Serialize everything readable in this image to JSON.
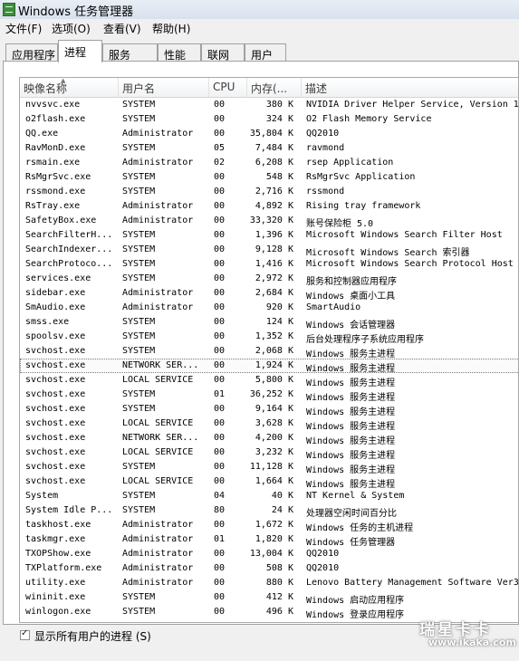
{
  "window": {
    "title": "Windows 任务管理器"
  },
  "menu": [
    "文件(F)",
    "选项(O)",
    "查看(V)",
    "帮助(H)"
  ],
  "tabs": [
    "应用程序",
    "进程",
    "服务",
    "性能",
    "联网",
    "用户"
  ],
  "columns": {
    "name": "映像名称",
    "user": "用户名",
    "cpu": "CPU",
    "mem": "内存(...",
    "desc": "描述"
  },
  "processes": [
    {
      "name": "nvvsvc.exe",
      "user": "SYSTEM",
      "cpu": "00",
      "mem": "380 K",
      "desc": "NVIDIA Driver Helper Service, Version 1"
    },
    {
      "name": "o2flash.exe",
      "user": "SYSTEM",
      "cpu": "00",
      "mem": "324 K",
      "desc": "O2 Flash Memory Service"
    },
    {
      "name": "QQ.exe",
      "user": "Administrator",
      "cpu": "00",
      "mem": "35,804 K",
      "desc": "QQ2010"
    },
    {
      "name": "RavMonD.exe",
      "user": "SYSTEM",
      "cpu": "05",
      "mem": "7,484 K",
      "desc": "ravmond"
    },
    {
      "name": "rsmain.exe",
      "user": "Administrator",
      "cpu": "02",
      "mem": "6,208 K",
      "desc": "rsep Application"
    },
    {
      "name": "RsMgrSvc.exe",
      "user": "SYSTEM",
      "cpu": "00",
      "mem": "548 K",
      "desc": "RsMgrSvc Application"
    },
    {
      "name": "rssmond.exe",
      "user": "SYSTEM",
      "cpu": "00",
      "mem": "2,716 K",
      "desc": "rssmond"
    },
    {
      "name": "RsTray.exe",
      "user": "Administrator",
      "cpu": "00",
      "mem": "4,892 K",
      "desc": "Rising tray framework"
    },
    {
      "name": "SafetyBox.exe",
      "user": "Administrator",
      "cpu": "00",
      "mem": "33,320 K",
      "desc": "账号保险柜 5.0"
    },
    {
      "name": "SearchFilterH...",
      "user": "SYSTEM",
      "cpu": "00",
      "mem": "1,396 K",
      "desc": "Microsoft Windows Search Filter Host"
    },
    {
      "name": "SearchIndexer...",
      "user": "SYSTEM",
      "cpu": "00",
      "mem": "9,128 K",
      "desc": "Microsoft Windows Search 索引器"
    },
    {
      "name": "SearchProtoco...",
      "user": "SYSTEM",
      "cpu": "00",
      "mem": "1,416 K",
      "desc": "Microsoft Windows Search Protocol Host"
    },
    {
      "name": "services.exe",
      "user": "SYSTEM",
      "cpu": "00",
      "mem": "2,972 K",
      "desc": "服务和控制器应用程序"
    },
    {
      "name": "sidebar.exe",
      "user": "Administrator",
      "cpu": "00",
      "mem": "2,684 K",
      "desc": "Windows 桌面小工具"
    },
    {
      "name": "SmAudio.exe",
      "user": "Administrator",
      "cpu": "00",
      "mem": "920 K",
      "desc": "SmartAudio"
    },
    {
      "name": "smss.exe",
      "user": "SYSTEM",
      "cpu": "00",
      "mem": "124 K",
      "desc": "Windows 会话管理器"
    },
    {
      "name": "spoolsv.exe",
      "user": "SYSTEM",
      "cpu": "00",
      "mem": "1,352 K",
      "desc": "后台处理程序子系统应用程序"
    },
    {
      "name": "svchost.exe",
      "user": "SYSTEM",
      "cpu": "00",
      "mem": "2,068 K",
      "desc": "Windows 服务主进程"
    },
    {
      "name": "svchost.exe",
      "user": "NETWORK SER...",
      "cpu": "00",
      "mem": "1,924 K",
      "desc": "Windows 服务主进程",
      "selected": true
    },
    {
      "name": "svchost.exe",
      "user": "LOCAL SERVICE",
      "cpu": "00",
      "mem": "5,800 K",
      "desc": "Windows 服务主进程"
    },
    {
      "name": "svchost.exe",
      "user": "SYSTEM",
      "cpu": "01",
      "mem": "36,252 K",
      "desc": "Windows 服务主进程"
    },
    {
      "name": "svchost.exe",
      "user": "SYSTEM",
      "cpu": "00",
      "mem": "9,164 K",
      "desc": "Windows 服务主进程"
    },
    {
      "name": "svchost.exe",
      "user": "LOCAL SERVICE",
      "cpu": "00",
      "mem": "3,628 K",
      "desc": "Windows 服务主进程"
    },
    {
      "name": "svchost.exe",
      "user": "NETWORK SER...",
      "cpu": "00",
      "mem": "4,200 K",
      "desc": "Windows 服务主进程"
    },
    {
      "name": "svchost.exe",
      "user": "LOCAL SERVICE",
      "cpu": "00",
      "mem": "3,232 K",
      "desc": "Windows 服务主进程"
    },
    {
      "name": "svchost.exe",
      "user": "SYSTEM",
      "cpu": "00",
      "mem": "11,128 K",
      "desc": "Windows 服务主进程"
    },
    {
      "name": "svchost.exe",
      "user": "LOCAL SERVICE",
      "cpu": "00",
      "mem": "1,664 K",
      "desc": "Windows 服务主进程"
    },
    {
      "name": "System",
      "user": "SYSTEM",
      "cpu": "04",
      "mem": "40 K",
      "desc": "NT Kernel & System"
    },
    {
      "name": "System Idle P...",
      "user": "SYSTEM",
      "cpu": "80",
      "mem": "24 K",
      "desc": "处理器空闲时间百分比"
    },
    {
      "name": "taskhost.exe",
      "user": "Administrator",
      "cpu": "00",
      "mem": "1,672 K",
      "desc": "Windows 任务的主机进程"
    },
    {
      "name": "taskmgr.exe",
      "user": "Administrator",
      "cpu": "01",
      "mem": "1,820 K",
      "desc": "Windows 任务管理器"
    },
    {
      "name": "TXOPShow.exe",
      "user": "Administrator",
      "cpu": "00",
      "mem": "13,004 K",
      "desc": "QQ2010"
    },
    {
      "name": "TXPlatform.exe",
      "user": "Administrator",
      "cpu": "00",
      "mem": "508 K",
      "desc": "QQ2010"
    },
    {
      "name": "utility.exe",
      "user": "Administrator",
      "cpu": "00",
      "mem": "880 K",
      "desc": "Lenovo Battery Management Software Ver3"
    },
    {
      "name": "wininit.exe",
      "user": "SYSTEM",
      "cpu": "00",
      "mem": "412 K",
      "desc": "Windows 启动应用程序"
    },
    {
      "name": "winlogon.exe",
      "user": "SYSTEM",
      "cpu": "00",
      "mem": "496 K",
      "desc": "Windows 登录应用程序"
    }
  ],
  "show_all_users": {
    "label": "显示所有用户的进程 (S)",
    "checked": true
  },
  "watermark": {
    "logo": "瑞星卡卡",
    "url": "www.ikaka.com"
  },
  "colors": {
    "titlebar": "#dbe4ef",
    "panel": "#ffffff",
    "chrome": "#f0f0f0"
  }
}
